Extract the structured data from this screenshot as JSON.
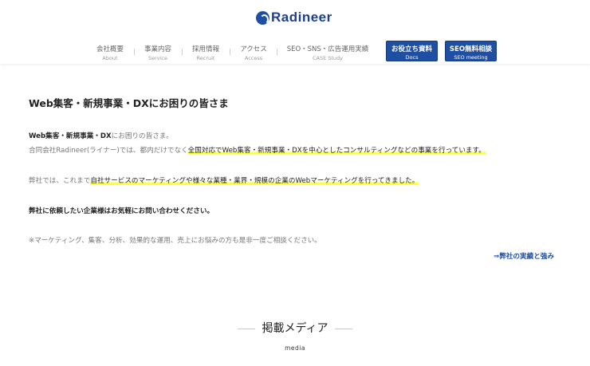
{
  "header": {
    "logo_text": "Radineer",
    "nav": [
      {
        "jp": "会社概要",
        "en": "About"
      },
      {
        "jp": "事業内容",
        "en": "Service"
      },
      {
        "jp": "採用情報",
        "en": "Recruit"
      },
      {
        "jp": "アクセス",
        "en": "Access"
      },
      {
        "jp": "SEO・SNS・広告運用実績",
        "en": "CASE Study"
      }
    ],
    "buttons": [
      {
        "jp": "お役立ち資料",
        "en": "Docs"
      },
      {
        "jp": "SEO無料相談",
        "en": "SEO meeting"
      }
    ]
  },
  "main": {
    "heading": "Web集客・新規事業・DXにお困りの皆さま",
    "line1_bold": "Web集客・新規事業・DX",
    "line1_rest": "にお困りの皆さま。",
    "line2_plain": "合同会社Radineer(ライナー)では、都内だけでなく",
    "line2_hl": "全国対応でWeb集客・新規事業・DXを中心としたコンサルティングなどの事業を行っています。",
    "line3_plain": "弊社では、これまで",
    "line3_hl": "自社サービスのマーケティングや様々な業種・業界・規模の企業のWebマーケティングを行ってきました。",
    "line4": "弊社に依頼したい企業様はお気軽にお問い合わせください。",
    "line5": "※マーケティング、集客、分析、効果的な運用、売上にお悩みの方も是非一度ご相談ください。",
    "link": "⇒弊社の実績と強み"
  },
  "media": {
    "title": "掲載メディア",
    "subtitle": "media"
  },
  "colors": {
    "brand": "#1e4fa3",
    "highlight": "#ffff3c"
  }
}
